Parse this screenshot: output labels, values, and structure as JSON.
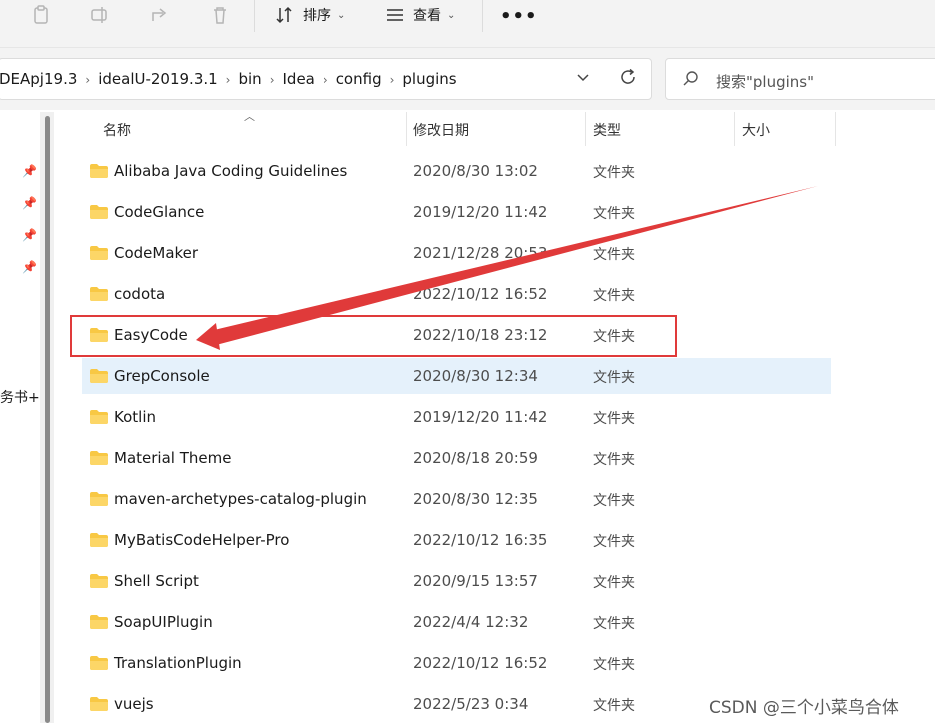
{
  "toolbar": {
    "sort_label": "排序",
    "view_label": "查看",
    "more_label": "•••"
  },
  "address": {
    "crumbs": [
      "DEApj19.3",
      "idealU-2019.3.1",
      "bin",
      "Idea",
      "config",
      "plugins"
    ]
  },
  "search": {
    "placeholder": "搜索\"plugins\""
  },
  "left_pane": {
    "partial_text": "务书+刃"
  },
  "columns": {
    "name": "名称",
    "date": "修改日期",
    "type": "类型",
    "size": "大小"
  },
  "files": [
    {
      "name": "Alibaba Java Coding Guidelines",
      "date": "2020/8/30 13:02",
      "type": "文件夹"
    },
    {
      "name": "CodeGlance",
      "date": "2019/12/20 11:42",
      "type": "文件夹"
    },
    {
      "name": "CodeMaker",
      "date": "2021/12/28 20:53",
      "type": "文件夹"
    },
    {
      "name": "codota",
      "date": "2022/10/12 16:52",
      "type": "文件夹"
    },
    {
      "name": "EasyCode",
      "date": "2022/10/18 23:12",
      "type": "文件夹",
      "highlighted": true
    },
    {
      "name": "GrepConsole",
      "date": "2020/8/30 12:34",
      "type": "文件夹",
      "selected": true
    },
    {
      "name": "Kotlin",
      "date": "2019/12/20 11:42",
      "type": "文件夹"
    },
    {
      "name": "Material Theme",
      "date": "2020/8/18 20:59",
      "type": "文件夹"
    },
    {
      "name": "maven-archetypes-catalog-plugin",
      "date": "2020/8/30 12:35",
      "type": "文件夹"
    },
    {
      "name": "MyBatisCodeHelper-Pro",
      "date": "2022/10/12 16:35",
      "type": "文件夹"
    },
    {
      "name": "Shell Script",
      "date": "2020/9/15 13:57",
      "type": "文件夹"
    },
    {
      "name": "SoapUIPlugin",
      "date": "2022/4/4 12:32",
      "type": "文件夹"
    },
    {
      "name": "TranslationPlugin",
      "date": "2022/10/12 16:52",
      "type": "文件夹"
    },
    {
      "name": "vuejs",
      "date": "2022/5/23 0:34",
      "type": "文件夹"
    }
  ],
  "watermark": "CSDN @三个小菜鸟合体",
  "colors": {
    "annotation": "#e03a3a",
    "selection": "#e5f1fb",
    "folder": "#f8c844"
  }
}
